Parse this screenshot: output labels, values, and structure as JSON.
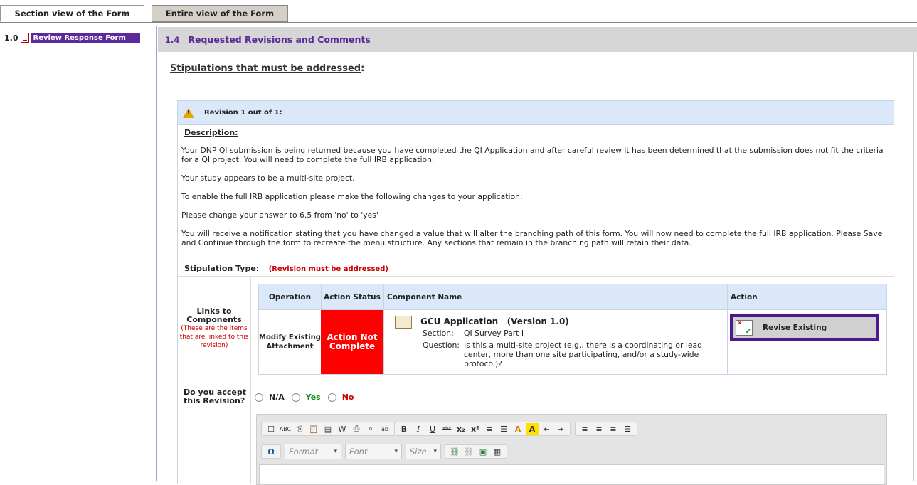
{
  "tabs": {
    "section_view": "Section view of the Form",
    "entire_view": "Entire view of the Form"
  },
  "nav": {
    "number": "1.0",
    "item": "Review Response Form"
  },
  "section": {
    "number": "1.4",
    "title": "Requested Revisions and Comments"
  },
  "stipulations": {
    "title": "Stipulations that must be addressed",
    "colon": ":"
  },
  "revision": {
    "header": "Revision 1 out of 1:",
    "description_label": "Description:",
    "paragraphs": [
      "Your DNP QI submission is being returned because you have completed the QI Application and after careful review it has been determined that the submission does not fit the criteria for a QI project. You will need to complete the full IRB application.",
      "Your study appears to be a multi-site project.",
      "To enable the full IRB application please make the following changes to your application:",
      "Please change your answer to 6.5 from 'no' to 'yes'",
      "You will receive a notification stating that you have changed a value that will alter the branching path of this form. You will now need to complete the full IRB application. Please Save and Continue through the form to recreate the menu structure. Any sections that remain in the branching path will retain their data."
    ],
    "stipulation_type_label": "Stipulation Type:",
    "stipulation_type_value": "(Revision must be addressed)"
  },
  "links": {
    "label": "Links to Components",
    "note": "(These are the items that are linked to this revision)"
  },
  "components": {
    "headers": {
      "operation": "Operation",
      "status": "Action Status",
      "name": "Component Name",
      "action": "Action"
    },
    "row": {
      "operation": "Modify Existing Attachment",
      "status": "Action Not Complete",
      "name": "GCU Application   (Version 1.0)",
      "section_label": "Section:",
      "section_value": "QI Survey Part I",
      "question_label": "Question:",
      "question_value": "Is this a multi-site project (e.g., there is a coordinating or lead center, more than one site participating, and/or a study-wide protocol)?",
      "action_button": "Revise Existing"
    }
  },
  "accept": {
    "label": "Do you accept this Revision?",
    "options": [
      "N/A",
      "Yes",
      "No"
    ],
    "colors": {
      "na": "#222222",
      "yes": "#1a8a1a",
      "no": "#cc0000"
    }
  },
  "editor": {
    "format_placeholder": "Format",
    "font_placeholder": "Font",
    "size_placeholder": "Size",
    "toolbar_icons": [
      "new-page-icon",
      "spellcheck-icon",
      "copy-icon",
      "paste-icon",
      "paste-text-icon",
      "paste-word-icon",
      "print-icon",
      "find-icon",
      "replace-icon",
      "bold-icon",
      "italic-icon",
      "underline-icon",
      "strikethrough-icon",
      "subscript-icon",
      "superscript-icon",
      "numbered-list-icon",
      "bulleted-list-icon",
      "text-color-icon",
      "background-color-icon",
      "outdent-icon",
      "indent-icon",
      "align-left-icon",
      "align-center-icon",
      "align-right-icon",
      "justify-icon",
      "special-char-icon",
      "link-icon",
      "unlink-icon",
      "image-icon",
      "table-icon"
    ]
  },
  "colors": {
    "accent_purple": "#5b2a9a",
    "status_red": "#ff0000",
    "header_blue": "#dbe8fa"
  }
}
